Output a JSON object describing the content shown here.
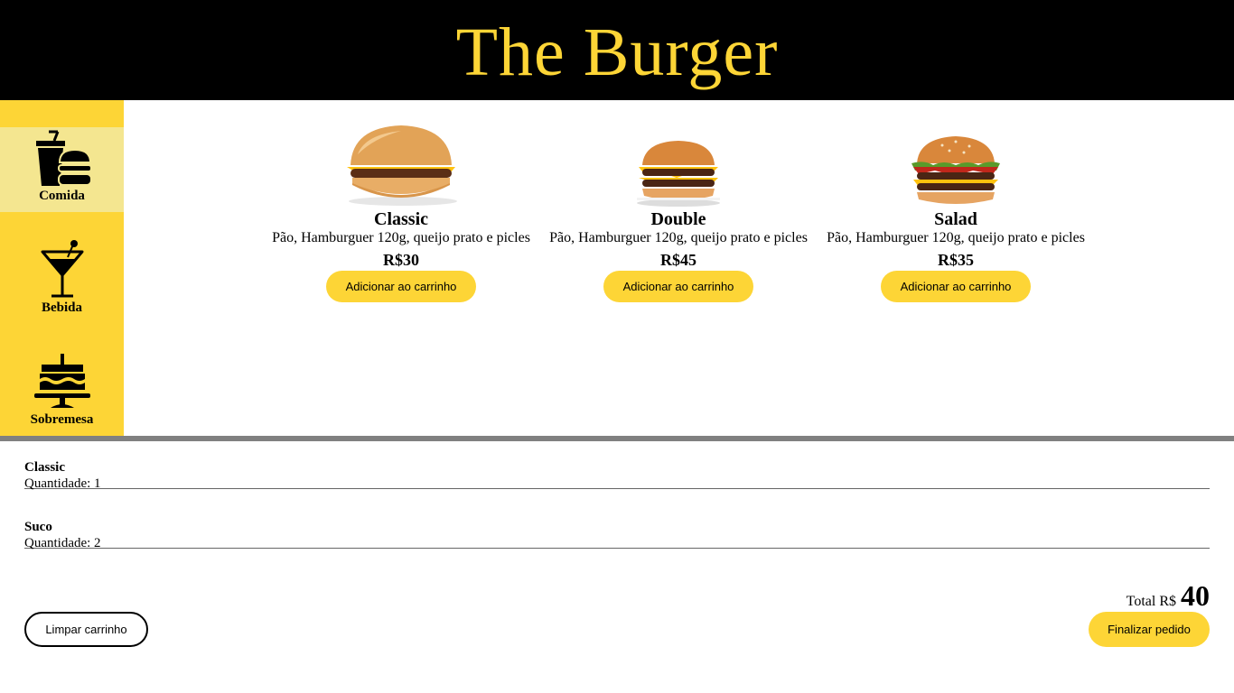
{
  "header": {
    "title": "The Burger"
  },
  "colors": {
    "accent": "#fdd536",
    "active_category": "#f4e690",
    "header_bg": "#000000",
    "divider": "#808080"
  },
  "sidebar": {
    "items": [
      {
        "label": "Comida",
        "icon": "food-icon",
        "active": true
      },
      {
        "label": "Bebida",
        "icon": "cocktail-icon",
        "active": false
      },
      {
        "label": "Sobremesa",
        "icon": "cake-icon",
        "active": false
      }
    ]
  },
  "products": [
    {
      "name": "Classic",
      "description": "Pão, Hamburguer 120g, queijo prato e picles",
      "price": "R$30",
      "button": "Adicionar ao carrinho"
    },
    {
      "name": "Double",
      "description": "Pão, Hamburguer 120g, queijo prato e picles",
      "price": "R$45",
      "button": "Adicionar ao carrinho"
    },
    {
      "name": "Salad",
      "description": "Pão, Hamburguer 120g, queijo prato e picles",
      "price": "R$35",
      "button": "Adicionar ao carrinho"
    }
  ],
  "cart": {
    "items": [
      {
        "name": "Classic",
        "quantity": "Quantidade: 1"
      },
      {
        "name": "Suco",
        "quantity": "Quantidade: 2"
      }
    ],
    "total_label": "Total R$",
    "total_value": "40",
    "clear_button": "Limpar carrinho",
    "finish_button": "Finalizar pedido"
  }
}
